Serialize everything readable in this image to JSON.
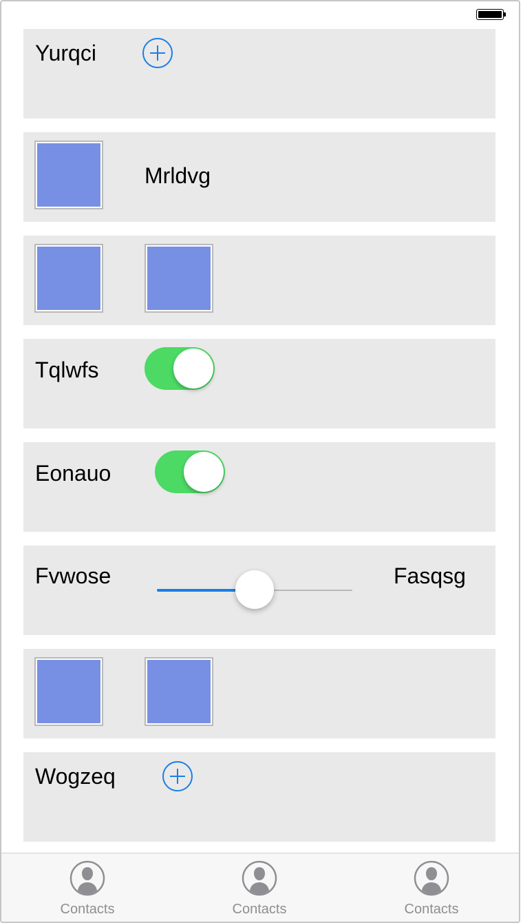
{
  "status_bar": {
    "battery_icon": "battery-icon"
  },
  "rows": {
    "row1": {
      "label": "Yurqci",
      "icon": "add-circle-icon"
    },
    "row2": {
      "label": "Mrldvg"
    },
    "row4": {
      "label": "Tqlwfs",
      "switch_on": true
    },
    "row5": {
      "label": "Eonauo",
      "switch_on": true
    },
    "row6": {
      "label": "Fvwose",
      "value_label": "Fasqsg",
      "slider_value": 0.5
    },
    "row8": {
      "label": "Wogzeq",
      "icon": "add-circle-icon"
    }
  },
  "tabbar": {
    "tabs": [
      {
        "label": "Contacts",
        "icon": "contact-icon"
      },
      {
        "label": "Contacts",
        "icon": "contact-icon"
      },
      {
        "label": "Contacts",
        "icon": "contact-icon"
      }
    ]
  },
  "colors": {
    "accent": "#1a7ee6",
    "switch_on": "#4cd964",
    "row_background": "#e9e9e9",
    "thumbnail": "#7890e3"
  }
}
